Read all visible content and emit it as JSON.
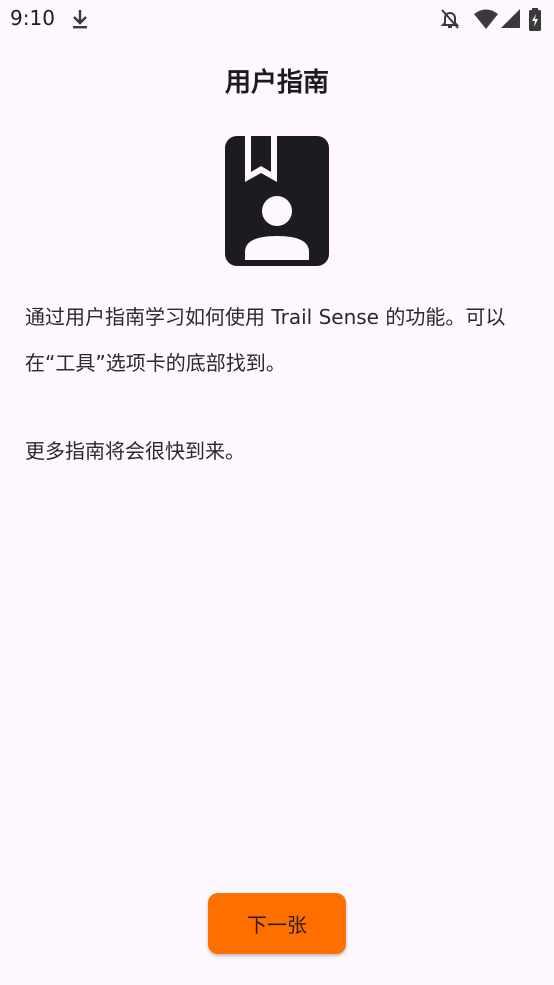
{
  "status_bar": {
    "time": "9:10",
    "icons": [
      "download-icon",
      "notifications-off-icon",
      "wifi-icon",
      "cell-signal-icon",
      "battery-charging-icon"
    ]
  },
  "page": {
    "title": "用户指南",
    "hero_icon": "user-guide-book-icon",
    "paragraph1": "通过用户指南学习如何使用 Trail Sense 的功能。可以在“工具”选项卡的底部找到。",
    "paragraph2": "更多指南将会很快到来。"
  },
  "actions": {
    "next_label": "下一张"
  },
  "colors": {
    "background": "#FEF7FF",
    "accent": "#FF6F00",
    "icon": "#1C1B1F"
  }
}
